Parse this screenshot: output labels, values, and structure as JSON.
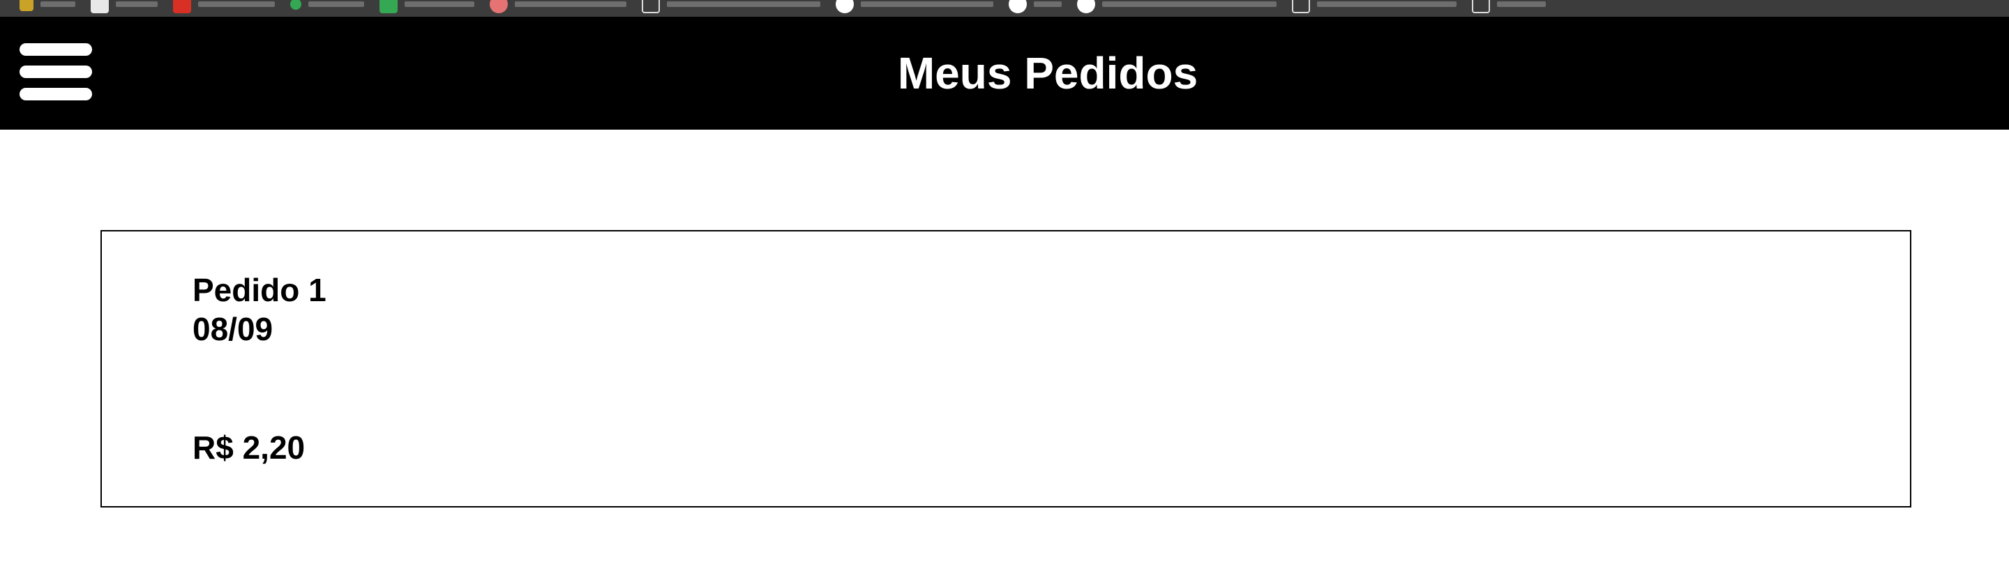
{
  "header": {
    "title": "Meus Pedidos",
    "menu_icon": "hamburger-menu-icon"
  },
  "orders": [
    {
      "name": "Pedido 1",
      "date": "08/09",
      "total": "R$ 2,20"
    }
  ],
  "colors": {
    "header_background": "#000000",
    "header_text": "#ffffff",
    "page_background": "#ffffff",
    "card_border": "#000000",
    "browser_bar": "#3c3c3c"
  }
}
